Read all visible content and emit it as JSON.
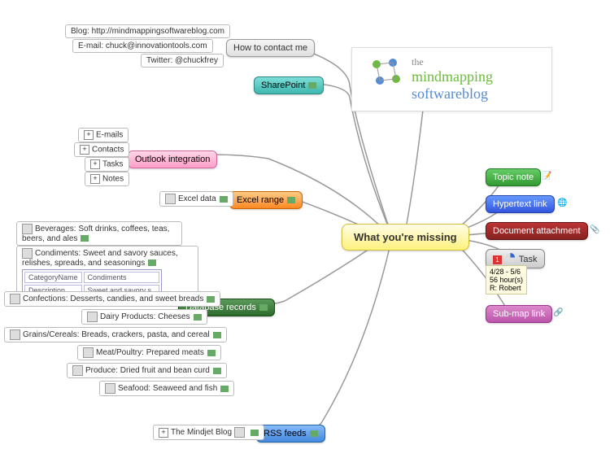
{
  "center": {
    "label": "What you're missing"
  },
  "logo": {
    "the": "the",
    "mind": "mindmapping",
    "soft": "softwareblog"
  },
  "left_branches": {
    "contact": {
      "label": "How to contact me",
      "items": [
        "Blog: http://mindmappingsoftwareblog.com",
        "E-mail: chuck@innovationtools.com",
        "Twitter: @chuckfrey"
      ]
    },
    "sharepoint": {
      "label": "SharePoint"
    },
    "outlook": {
      "label": "Outlook integration",
      "items": [
        "E-mails",
        "Contacts",
        "Tasks",
        "Notes"
      ]
    },
    "excel": {
      "label": "Excel range",
      "items": [
        "Excel data"
      ]
    },
    "database": {
      "label": "Database records",
      "items": [
        "Beverages: Soft drinks, coffees, teas, beers, and ales",
        "Condiments: Sweet and savory sauces, relishes, spreads, and seasonings",
        "Confections: Desserts, candies, and sweet breads",
        "Dairy Products: Cheeses",
        "Grains/Cereals: Breads, crackers, pasta, and cereal",
        "Meat/Poultry: Prepared meats",
        "Produce: Dried fruit and bean curd",
        "Seafood: Seaweed and fish"
      ],
      "condiment_table": {
        "r1c1": "CategoryName",
        "r1c2": "Condiments",
        "r2c1": "Description",
        "r2c2": "Sweet and savory s.."
      }
    },
    "rss": {
      "label": "RSS feeds",
      "items": [
        "The Mindjet Blog"
      ]
    }
  },
  "right_branches": {
    "topic_note": {
      "label": "Topic note"
    },
    "hyperlink": {
      "label": "Hypertext link"
    },
    "document": {
      "label": "Document attachment"
    },
    "task": {
      "label": "Task",
      "detail1": "4/28 - 5/6",
      "detail2": "56 hour(s)",
      "detail3": "R: Robert"
    },
    "submap": {
      "label": "Sub-map link"
    }
  },
  "symbols": {
    "plus": "+",
    "minus": "−"
  }
}
